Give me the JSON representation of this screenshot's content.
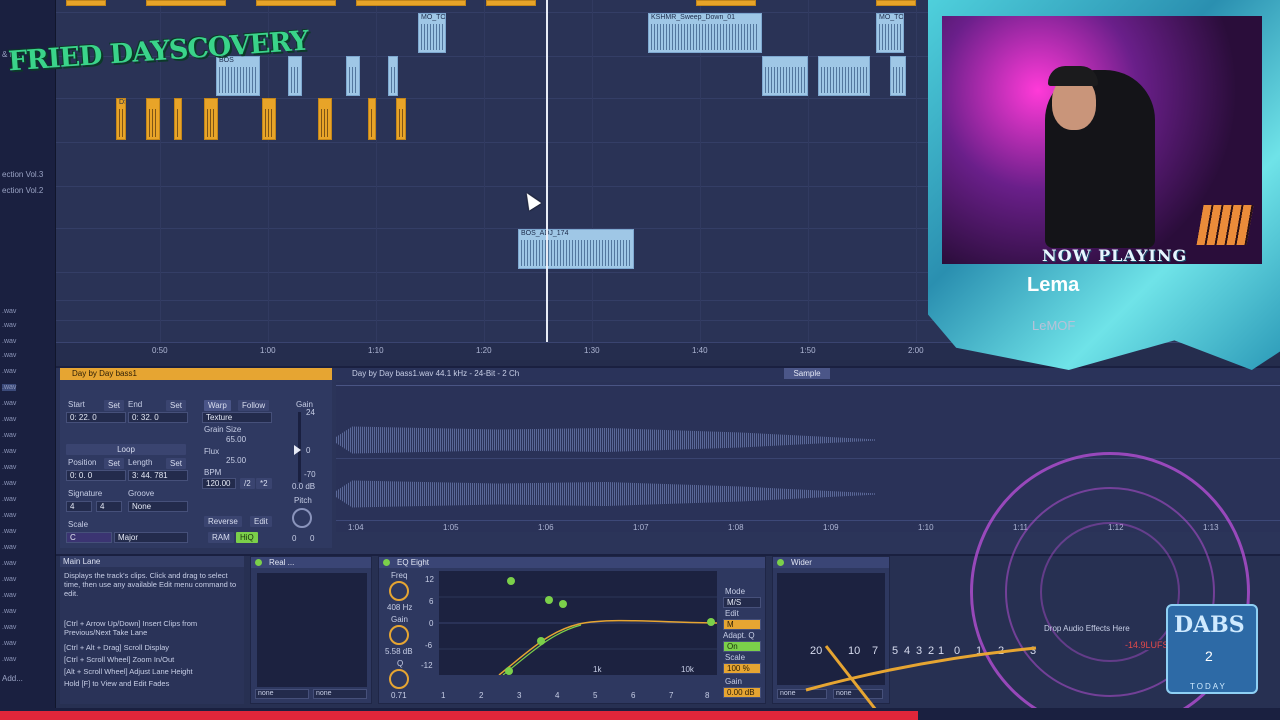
{
  "logo": {
    "text": "FRIED DAYSCOVERY"
  },
  "browser": {
    "items": [
      "& FX",
      "ection Vol.3",
      "ection Vol.2",
      "Add..."
    ],
    "wav_label": ".wav"
  },
  "arrangement": {
    "ruler": [
      "0:50",
      "1:00",
      "1:10",
      "1:20",
      "1:30",
      "1:40",
      "1:50",
      "2:00"
    ],
    "clips": [
      {
        "name": "MO_TO"
      },
      {
        "name": "KSHMR_Sweep_Down_01"
      },
      {
        "name": "MO_TO"
      },
      {
        "name": "BOS"
      },
      {
        "name": "BOS_ADJ_174"
      },
      {
        "name": "DS"
      }
    ]
  },
  "clip_view": {
    "title": "Day by Day bass1",
    "start_label": "Start",
    "end_label": "End",
    "set_label": "Set",
    "start_value": "0: 22. 0",
    "end_value": "0: 32. 0",
    "warp_label": "Warp",
    "follow_label": "Follow",
    "warp_mode": "Texture",
    "grain_size_label": "Grain Size",
    "grain_size_value": "65.00",
    "flux_label": "Flux",
    "flux_value": "25.00",
    "bpm_label": "BPM",
    "bpm_value": "120.00",
    "half": "/2",
    "double": "*2",
    "gain_label": "Gain",
    "gain_top": "24",
    "gain_zero": "0",
    "gain_bottom": "-70",
    "gain_value": "0.0 dB",
    "loop_label": "Loop",
    "position_label": "Position",
    "length_label": "Length",
    "position_value": "0: 0. 0",
    "length_value": "3: 44. 781",
    "signature_label": "Signature",
    "groove_label": "Groove",
    "sig_num": "4",
    "sig_den": "4",
    "groove_value": "None",
    "scale_label": "Scale",
    "scale_root": "C",
    "scale_mode": "Major",
    "pitch_label": "Pitch",
    "pitch_st": "0",
    "pitch_cent": "0",
    "reverse_label": "Reverse",
    "edit_label": "Edit",
    "ram_label": "RAM",
    "hiq_label": "HiQ"
  },
  "sample": {
    "header": "Day by Day bass1.wav  44.1 kHz - 24-Bit - 2 Ch",
    "button": "Sample",
    "ruler": [
      "1:04",
      "1:05",
      "1:06",
      "1:07",
      "1:08",
      "1:09",
      "1:10",
      "1:11",
      "1:12",
      "1:13"
    ]
  },
  "info": {
    "title": "Main Lane",
    "p1": "Displays the track's clips. Click and drag to select time, then use any available Edit menu command to edit.",
    "p2": "[Ctrl + Arrow Up/Down] Insert Clips from Previous/Next Take Lane",
    "p3": "[Ctrl + Alt + Drag] Scroll Display",
    "p4": "[Ctrl + Scroll Wheel] Zoom In/Out",
    "p5": "[Alt + Scroll Wheel] Adjust Lane Height",
    "p6": "Hold [F] to View and Edit Fades"
  },
  "devices": {
    "real": {
      "title": "Real ...",
      "sel1": "none",
      "sel2": "none"
    },
    "eq": {
      "title": "EQ Eight",
      "freq_label": "Freq",
      "freq_value": "408 Hz",
      "gain_label": "Gain",
      "gain_value": "5.58 dB",
      "q_label": "Q",
      "q_value": "0.71",
      "db_ticks": [
        "12",
        "6",
        "0",
        "-6",
        "-12"
      ],
      "freq_ticks": [
        "1k",
        "10k"
      ],
      "mode_label": "Mode",
      "mode_value": "M/S",
      "edit_label": "Edit",
      "edit_value": "M",
      "adapt_label": "Adapt. Q",
      "adapt_value": "On",
      "scale_label": "Scale",
      "scale_value": "100 %",
      "out_gain_label": "Gain",
      "out_gain_value": "0.00 dB",
      "bands": [
        "1",
        "2",
        "3",
        "4",
        "5",
        "6",
        "7",
        "8"
      ]
    },
    "wider": {
      "title": "Wider",
      "sel1": "none",
      "sel2": "none"
    }
  },
  "overlay": {
    "now_playing": "NOW PLAYING",
    "song": "Lema",
    "artist": "LeMOF",
    "drop_text": "Drop Audio Effects Here",
    "lufs": "-14.9LUFS",
    "meter_scale": [
      "20",
      "10",
      "7",
      "5",
      "4",
      "3",
      "2",
      "1",
      "0",
      "1",
      "2",
      "3"
    ],
    "badge_title": "DABS",
    "badge_num": "2",
    "badge_sub": "TODAY"
  },
  "colors": {
    "accent": "#e6a532",
    "clip_blue": "#9fc7e6",
    "device_green": "#7bd04a",
    "red_bar": "#e0263a"
  }
}
